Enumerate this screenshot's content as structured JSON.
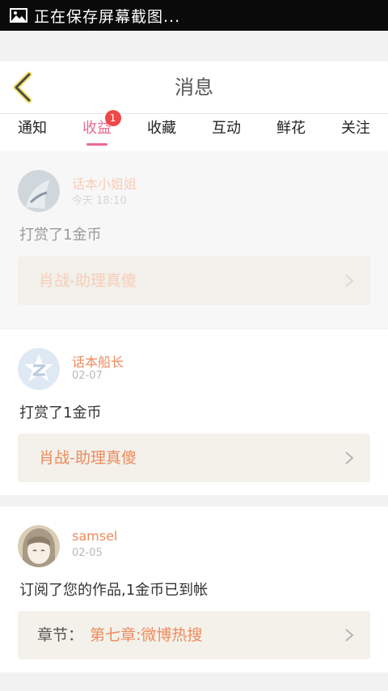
{
  "status_bar": {
    "text": "正在保存屏幕截图..."
  },
  "header": {
    "title": "消息"
  },
  "tabs": [
    {
      "label": "通知"
    },
    {
      "label": "收益",
      "badge": "1",
      "active": true
    },
    {
      "label": "收藏"
    },
    {
      "label": "互动"
    },
    {
      "label": "鲜花"
    },
    {
      "label": "关注"
    }
  ],
  "notifications": [
    {
      "user": "话本小姐姐",
      "date": "今天 18:10",
      "action": "打赏了1金币",
      "work": "肖战-助理真傻"
    },
    {
      "user": "话本船长",
      "date": "02-07",
      "action": "打赏了1金币",
      "work": "肖战-助理真傻"
    },
    {
      "user": "samsel",
      "date": "02-05",
      "action": "订阅了您的作品,1金币已到帐",
      "chapter_prefix": "章节：",
      "work": "第七章:微博热搜"
    }
  ],
  "colors": {
    "accent_pink": "#e96a8f",
    "name_orange": "#f08a5d",
    "badge_red": "#f04848"
  }
}
